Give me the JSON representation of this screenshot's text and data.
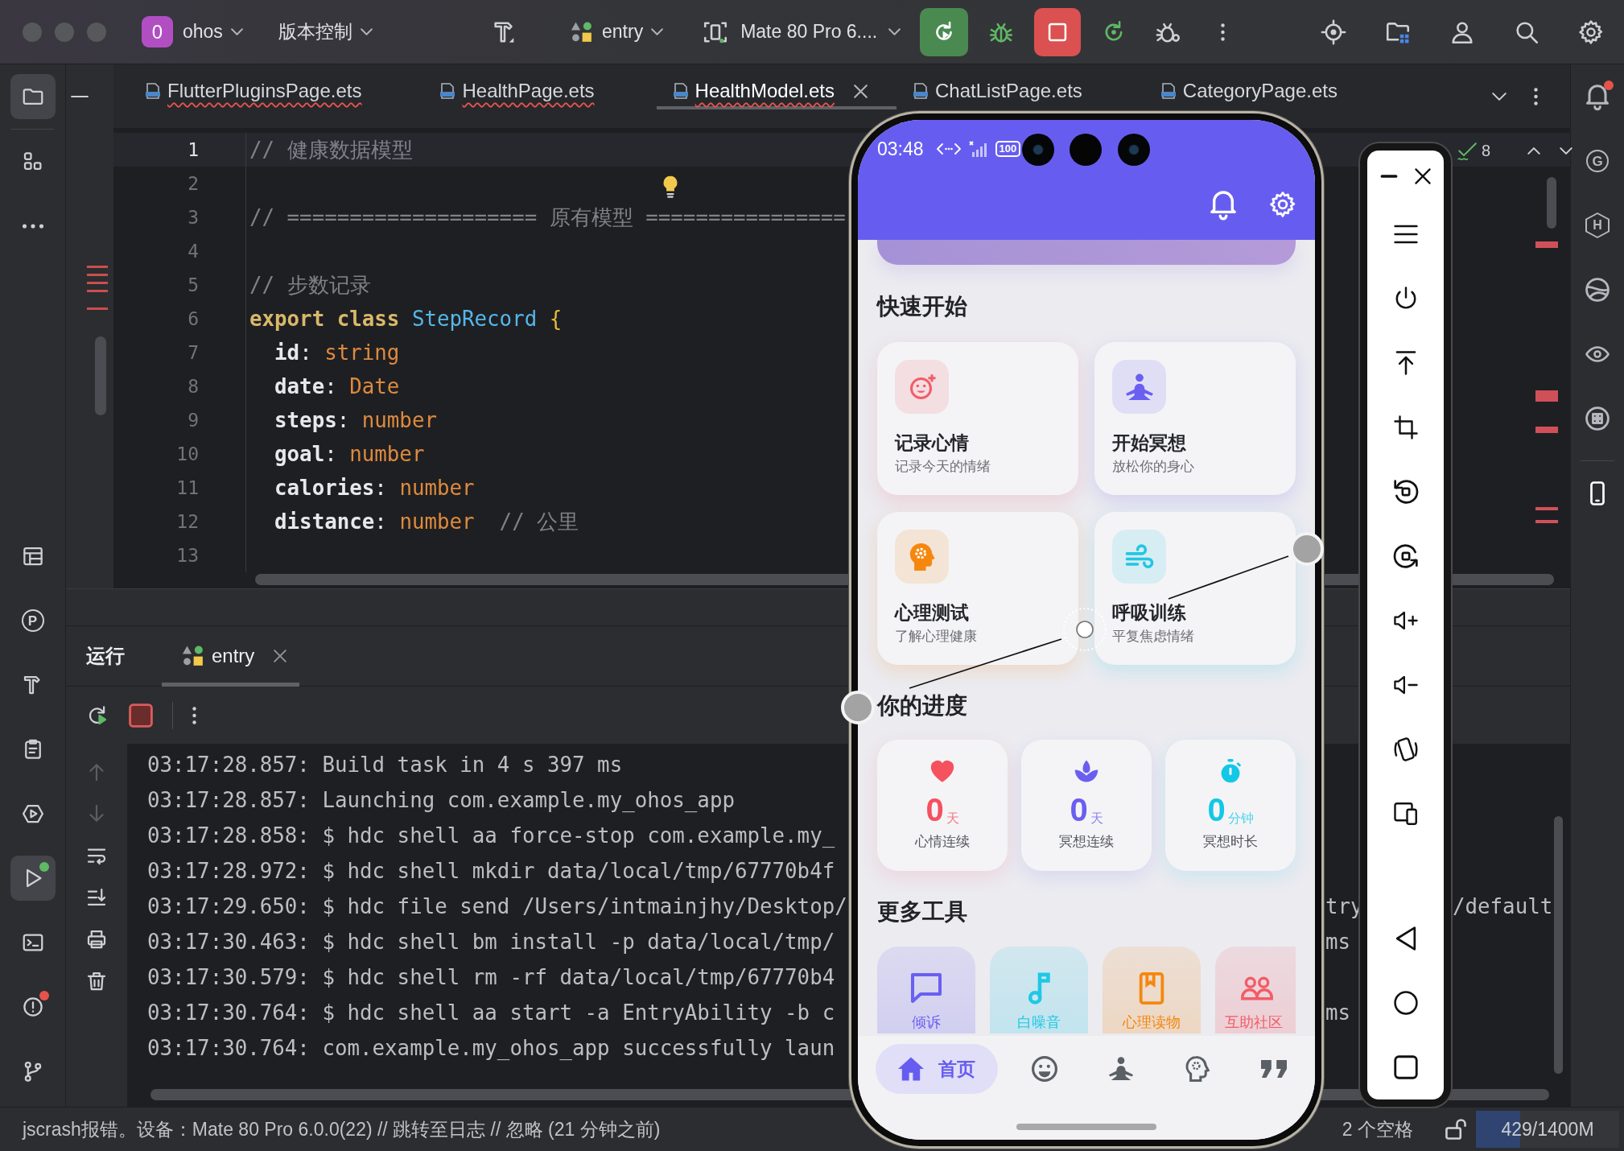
{
  "title_bar": {
    "project_badge": "0",
    "project": "ohos",
    "vcs": "版本控制",
    "run_config": "entry",
    "device": "Mate 80 Pro 6...."
  },
  "left_toolbar": {
    "top": [
      {
        "selected": true
      },
      {
        "selected": false
      },
      {
        "selected": false
      }
    ],
    "bottom": [
      {
        "selected": false
      },
      {
        "selected": false,
        "glyph": "P"
      },
      {
        "selected": false
      },
      {
        "selected": false
      },
      {
        "selected": false
      },
      {
        "selected": true,
        "color": "#5fb865"
      },
      {
        "selected": false
      },
      {
        "selected": false,
        "color": "#e5534b"
      },
      {
        "selected": false
      }
    ]
  },
  "editor_tabs": [
    {
      "label": "FlutterPluginsPage.ets",
      "selected": false,
      "has_errors": true
    },
    {
      "label": "HealthPage.ets",
      "selected": false,
      "has_errors": true
    },
    {
      "label": "HealthModel.ets",
      "selected": true,
      "has_errors": true
    },
    {
      "label": "ChatListPage.ets",
      "selected": false,
      "has_errors": false
    },
    {
      "label": "CategoryPage.ets",
      "selected": false,
      "has_errors": false
    }
  ],
  "inspections": {
    "weak_warnings": "8"
  },
  "editor": {
    "lines": [
      {
        "number": "1",
        "current": true,
        "tokens": [
          {
            "kind": "comment",
            "text": "// 健康数据模型"
          }
        ]
      },
      {
        "number": "2",
        "current": false
      },
      {
        "number": "3",
        "current": false,
        "tokens": [
          {
            "kind": "comment",
            "text": "// ==================== 原有模型 ================"
          }
        ]
      },
      {
        "number": "4",
        "current": false
      },
      {
        "number": "5",
        "current": false,
        "tokens": [
          {
            "kind": "comment",
            "text": "// 步数记录"
          }
        ]
      },
      {
        "number": "6",
        "current": false,
        "tokens": [
          {
            "kind": "keyword",
            "text": "export class "
          },
          {
            "kind": "class_name",
            "text": "StepRecord "
          },
          {
            "kind": "brace",
            "text": "{"
          }
        ]
      },
      {
        "number": "7",
        "current": false,
        "tokens": [
          {
            "kind": "property",
            "text": "  id"
          },
          {
            "kind": "punct",
            "text": ": "
          },
          {
            "kind": "type",
            "text": "string"
          }
        ]
      },
      {
        "number": "8",
        "current": false,
        "tokens": [
          {
            "kind": "property",
            "text": "  date"
          },
          {
            "kind": "punct",
            "text": ": "
          },
          {
            "kind": "type",
            "text": "Date"
          }
        ]
      },
      {
        "number": "9",
        "current": false,
        "tokens": [
          {
            "kind": "property",
            "text": "  steps"
          },
          {
            "kind": "punct",
            "text": ": "
          },
          {
            "kind": "type",
            "text": "number"
          }
        ]
      },
      {
        "number": "10",
        "current": false,
        "tokens": [
          {
            "kind": "property",
            "text": "  goal"
          },
          {
            "kind": "punct",
            "text": ": "
          },
          {
            "kind": "type",
            "text": "number"
          }
        ]
      },
      {
        "number": "11",
        "current": false,
        "tokens": [
          {
            "kind": "property",
            "text": "  calories"
          },
          {
            "kind": "punct",
            "text": ": "
          },
          {
            "kind": "type",
            "text": "number"
          }
        ]
      },
      {
        "number": "12",
        "current": false,
        "tokens": [
          {
            "kind": "property",
            "text": "  distance"
          },
          {
            "kind": "punct",
            "text": ": "
          },
          {
            "kind": "type",
            "text": "number"
          },
          {
            "kind": "comment",
            "text": "  // 公里"
          }
        ]
      },
      {
        "number": "13",
        "current": false
      }
    ]
  },
  "run_panel": {
    "title": "运行",
    "tabs": [
      {
        "label": "entry",
        "selected": true
      }
    ],
    "console": [
      {
        "text": "03:17:28.857: Build task in 4 s 397 ms"
      },
      {
        "text": "03:17:28.857: Launching com.example.my_ohos_app"
      },
      {
        "text": "03:17:28.858: $ hdc shell aa force-stop com.example.my_"
      },
      {
        "text": "03:17:28.972: $ hdc shell mkdir data/local/tmp/67770b4f"
      },
      {
        "text": "03:17:29.650: $ hdc file send /Users/intmainjhy/Desktop/",
        "tail": [
          "try",
          "/default"
        ]
      },
      {
        "text": "03:17:30.463: $ hdc shell bm install -p data/local/tmp/",
        "tail": [
          "ms"
        ]
      },
      {
        "text": "03:17:30.579: $ hdc shell rm -rf data/local/tmp/67770b4"
      },
      {
        "text": "03:17:30.764: $ hdc shell aa start -a EntryAbility -b c",
        "tail": [
          "ms"
        ]
      },
      {
        "text": "03:17:30.764: com.example.my_ohos_app successfully laun"
      }
    ]
  },
  "status_bar": {
    "message": "jscrash报错。设备：Mate 80 Pro 6.0.0(22) // 跳转至日志 // 忽略 (21 分钟之前)",
    "indent": "2 个空格",
    "memory": {
      "reading": "429/1400M",
      "level": 0.31
    }
  },
  "right_toolbar": [
    {
      "selected": false,
      "color": "#e5534b"
    },
    {
      "selected": false,
      "glyph": "G"
    },
    {
      "selected": false,
      "glyph": "H"
    },
    {
      "selected": false
    },
    {
      "selected": false
    },
    {
      "selected": false
    },
    {
      "selected": true
    }
  ],
  "phone": {
    "status_bar": {
      "time": "03:48",
      "battery": "100"
    },
    "quick_start": {
      "title": "快速开始",
      "cards": [
        {
          "title": "记录心情",
          "subtitle": "记录今天的情绪",
          "color": "#f25c67"
        },
        {
          "title": "开始冥想",
          "subtitle": "放松你的身心",
          "color": "#6a5ff0"
        },
        {
          "title": "心理测试",
          "subtitle": "了解心理健康",
          "color": "#f5870f"
        },
        {
          "title": "呼吸训练",
          "subtitle": "平复焦虑情绪",
          "color": "#22c6e3"
        }
      ]
    },
    "progress": {
      "title": "你的进度",
      "stats": [
        {
          "value": "0",
          "unit": "天",
          "label": "心情连续",
          "color": "#f5515f"
        },
        {
          "value": "0",
          "unit": "天",
          "label": "冥想连续",
          "color": "#6a5ff0"
        },
        {
          "value": "0",
          "unit": "分钟",
          "label": "冥想时长",
          "color": "#12c8e6"
        }
      ]
    },
    "tools": {
      "title": "更多工具",
      "items": [
        {
          "label": "倾诉",
          "color": "#6a5ff0"
        },
        {
          "label": "白噪音",
          "color": "#1ec8e6"
        },
        {
          "label": "心理读物",
          "color": "#f5870f"
        },
        {
          "label": "互助社区",
          "color": "#f25c67"
        }
      ]
    },
    "bottom_nav": [
      {
        "label": "首页",
        "selected": true
      },
      {
        "selected": false
      },
      {
        "selected": false
      },
      {
        "selected": false
      },
      {
        "selected": false
      }
    ]
  }
}
